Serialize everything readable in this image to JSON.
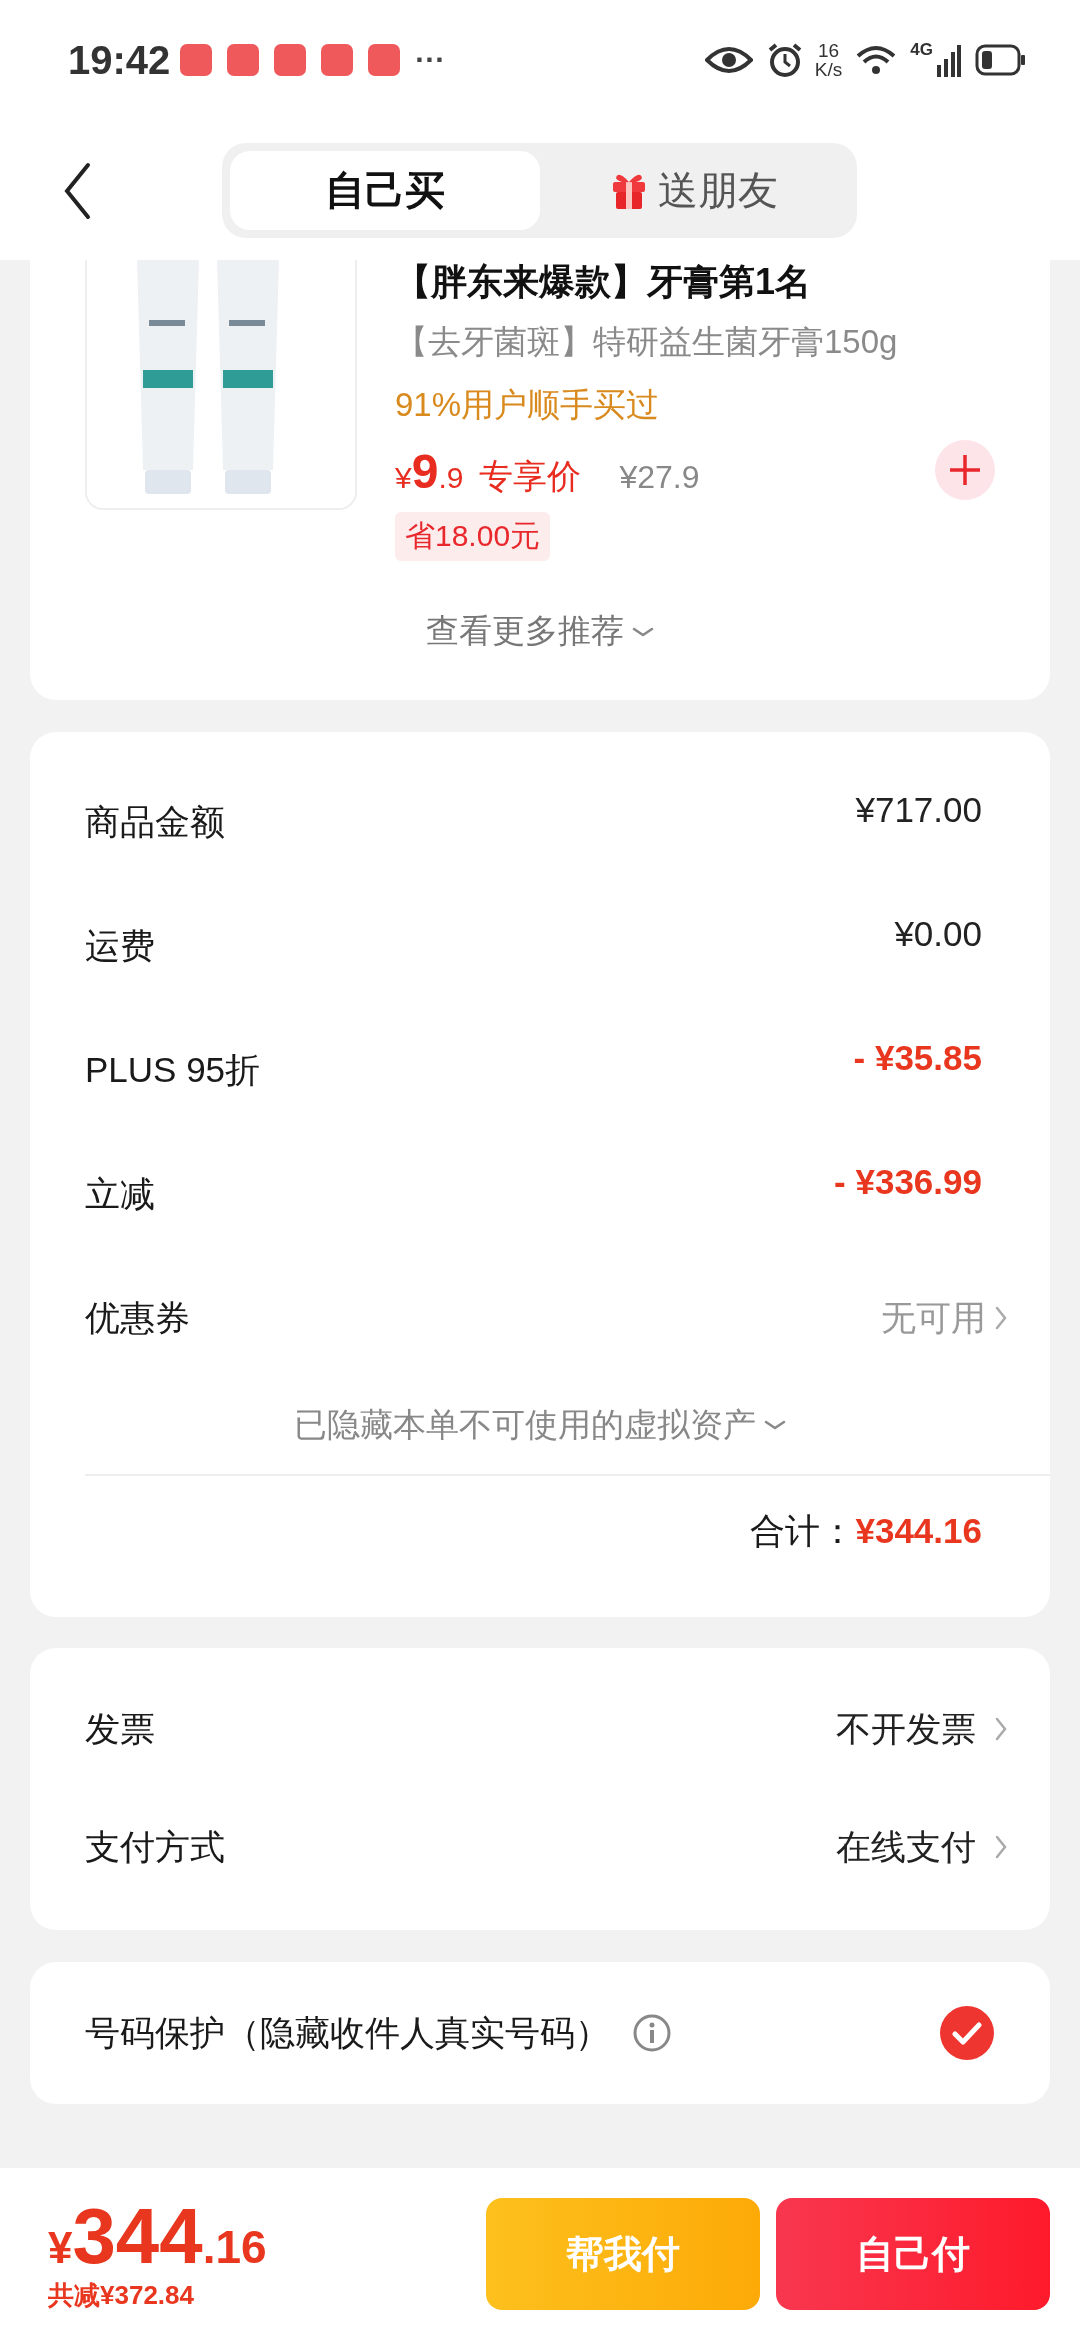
{
  "status_bar": {
    "time": "19:42",
    "more": "···",
    "net_speed": "16",
    "net_unit": "K/s",
    "network": "4G"
  },
  "header": {
    "tabs": [
      {
        "label": "自己买",
        "selected": true,
        "kind": "plain"
      },
      {
        "label": "送朋友",
        "selected": false,
        "kind": "gift"
      }
    ]
  },
  "product": {
    "title": "【胖东来爆款】牙膏第1名",
    "subtitle": "【去牙菌斑】特研益生菌牙膏150g",
    "social_proof": "91%用户顺手买过",
    "price_currency": "¥",
    "price_integer": "9",
    "price_decimal": ".9",
    "price_label": "专享价",
    "original_price": "¥27.9",
    "saving": "省18.00元",
    "more": "查看更多推荐"
  },
  "summary": {
    "rows": [
      {
        "label": "商品金额",
        "value": "¥717.00",
        "kind": "amount"
      },
      {
        "label": "运费",
        "value": "¥0.00",
        "kind": "amount"
      },
      {
        "label": "PLUS 95折",
        "value": "- ¥35.85",
        "kind": "discount"
      },
      {
        "label": "立减",
        "value": "- ¥336.99",
        "kind": "discount"
      },
      {
        "label": "优惠券",
        "value": "无可用",
        "kind": "link"
      }
    ],
    "hidden_note": "已隐藏本单不可使用的虚拟资产",
    "total_label": "合计：",
    "total": "¥344.16"
  },
  "options": [
    {
      "label": "发票",
      "value": "不开发票"
    },
    {
      "label": "支付方式",
      "value": "在线支付"
    }
  ],
  "protection": {
    "label": "号码保护（隐藏收件人真实号码）",
    "checked": true
  },
  "footer": {
    "currency": "¥",
    "integer": "344",
    "decimal": ".16",
    "savings": "共减¥372.84",
    "buttons": [
      {
        "label": "帮我付",
        "kind": "secondary"
      },
      {
        "label": "自己付",
        "kind": "primary"
      }
    ]
  }
}
